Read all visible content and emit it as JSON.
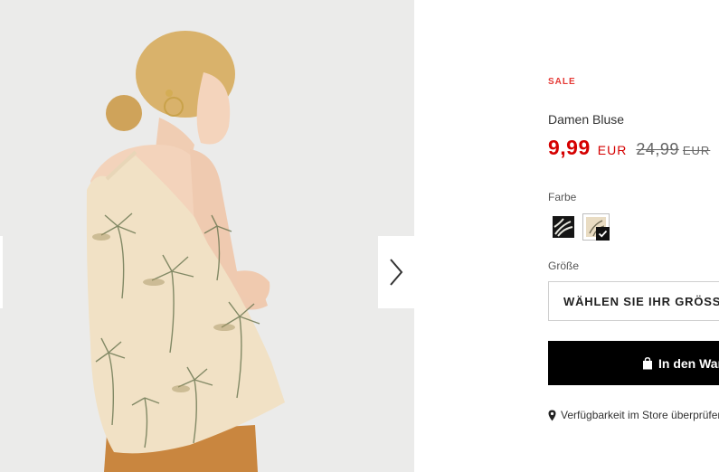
{
  "gallery": {
    "image_alt": "Damen Bluse",
    "next_icon": "chevron-right-icon"
  },
  "product": {
    "badge": "SALE",
    "title": "Damen Bluse",
    "price_current": "9,99",
    "price_current_currency": "EUR",
    "price_old": "24,99",
    "price_old_currency": "EUR"
  },
  "options": {
    "color_label": "Farbe",
    "colors": [
      {
        "name": "black-palm-print",
        "selected": false
      },
      {
        "name": "beige-palm-print",
        "selected": true
      }
    ],
    "size_label": "Größe",
    "size_placeholder": "WÄHLEN SIE IHR GRÖSSE"
  },
  "actions": {
    "cart_label": "In den Warenkorb",
    "cart_icon": "shopping-bag-icon",
    "store_label": "Verfügbarkeit im Store überprüfen",
    "store_icon": "map-pin-icon"
  },
  "colors": {
    "sale_red": "#d50000",
    "badge_red": "#e53935",
    "button_black": "#000000"
  }
}
